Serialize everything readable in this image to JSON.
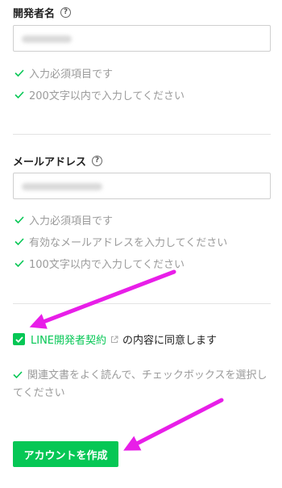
{
  "developer": {
    "label": "開発者名",
    "help": "?",
    "rules": [
      "入力必須項目です",
      "200文字以内で入力してください"
    ]
  },
  "email": {
    "label": "メールアドレス",
    "help": "?",
    "rules": [
      "入力必須項目です",
      "有効なメールアドレスを入力してください",
      "100文字以内で入力してください"
    ]
  },
  "agreement": {
    "link": "LINE開発者契約",
    "suffix": "の内容に同意します",
    "note": "関連文書をよく読んで、チェックボックスを選択してください"
  },
  "submit_label": "アカウントを作成",
  "colors": {
    "accent": "#06c755",
    "annotation": "#e81ee8"
  }
}
